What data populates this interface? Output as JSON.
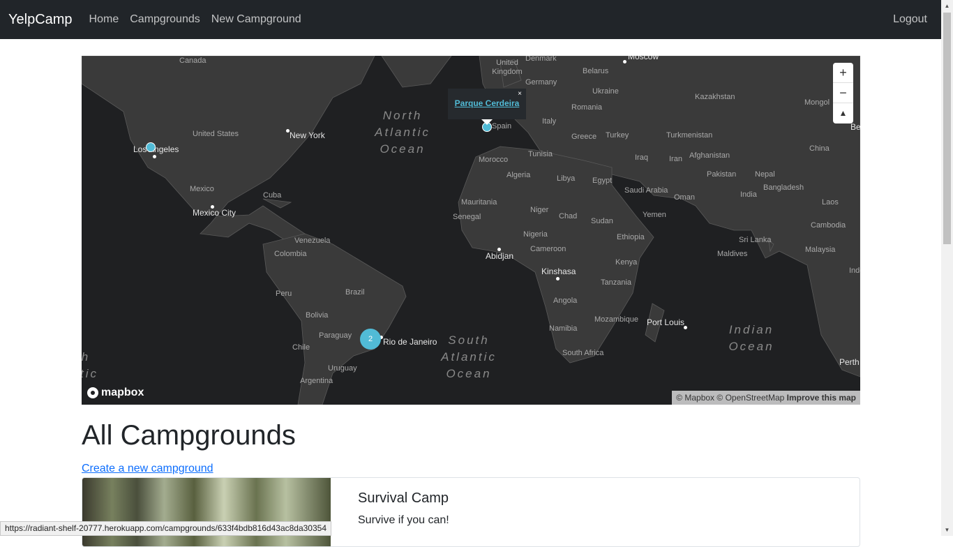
{
  "nav": {
    "brand": "YelpCamp",
    "links": [
      "Home",
      "Campgrounds",
      "New Campground"
    ],
    "logout": "Logout"
  },
  "map": {
    "countries": [
      "Canada",
      "United States",
      "Mexico",
      "Cuba",
      "Venezuela",
      "Colombia",
      "Peru",
      "Brazil",
      "Bolivia",
      "Paraguay",
      "Chile",
      "Uruguay",
      "Argentina",
      "Denmark",
      "United Kingdom",
      "Germany",
      "Belarus",
      "Ukraine",
      "Romania",
      "Italy",
      "Spain",
      "Greece",
      "Turkey",
      "Tunisia",
      "Morocco",
      "Algeria",
      "Libya",
      "Egypt",
      "Mauritania",
      "Senegal",
      "Niger",
      "Chad",
      "Sudan",
      "Nigeria",
      "Ethiopia",
      "Cameroon",
      "Kenya",
      "Tanzania",
      "Angola",
      "Mozambique",
      "Namibia",
      "South Africa",
      "Kazakhstan",
      "Mongol",
      "Turkmenistan",
      "Afghanistan",
      "Iraq",
      "Iran",
      "Pakistan",
      "Saudi Arabia",
      "Oman",
      "Yemen",
      "Nepal",
      "India",
      "Bangladesh",
      "China",
      "Laos",
      "Cambodia",
      "Sri Lanka",
      "Malaysia",
      "Maldives",
      "Indo"
    ],
    "cities": [
      "Moscow",
      "New York",
      "Los Angeles",
      "Mexico City",
      "Abidjan",
      "Kinshasa",
      "Rio de Janeiro",
      "Port Louis",
      "Perth",
      "Be"
    ],
    "oceans": {
      "north_atlantic": "North Atlantic Ocean",
      "south_atlantic": "South Atlantic Ocean",
      "indian": "Indian Ocean",
      "partial": "h tic"
    },
    "popup": {
      "title": "Parque Cerdeira",
      "close": "×"
    },
    "cluster_count": "2",
    "zoom": {
      "in": "+",
      "out": "−",
      "compass": "▲"
    },
    "logo": "mapbox",
    "attribution": {
      "mapbox": "© Mapbox",
      "osm": "© OpenStreetMap",
      "improve": "Improve this map"
    }
  },
  "main": {
    "title": "All Campgrounds",
    "create_link": "Create a new campground",
    "campgrounds": [
      {
        "title": "Survival Camp",
        "description": "Survive if you can!"
      }
    ]
  },
  "status_url": "https://radiant-shelf-20777.herokuapp.com/campgrounds/633f4bdb816d43ac8da30354"
}
